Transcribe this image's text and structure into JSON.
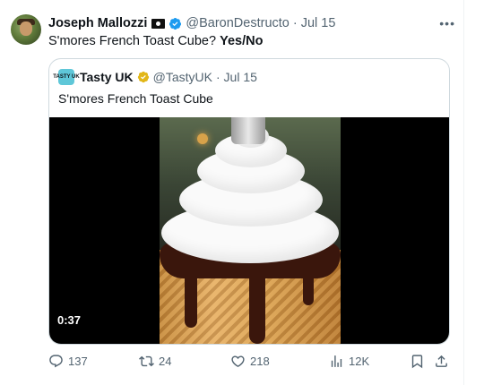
{
  "tweet": {
    "author_name": "Joseph Mallozzi",
    "author_handle": "@BaronDestructo",
    "date": "· Jul 15",
    "text_main": "S'mores French Toast Cube?",
    "text_bold": "Yes/No"
  },
  "quote": {
    "avatar_text": "TASTY UK",
    "author_name": "Tasty UK",
    "author_handle": "@TastyUK",
    "date": "· Jul 15",
    "text": "S'mores French Toast Cube",
    "video_timestamp": "0:37"
  },
  "actions": {
    "replies": "137",
    "retweets": "24",
    "likes": "218",
    "views": "12K"
  },
  "colors": {
    "verified_blue": "#1d9bf0",
    "verified_gold": "#e2b719",
    "muted_text": "#536471"
  }
}
